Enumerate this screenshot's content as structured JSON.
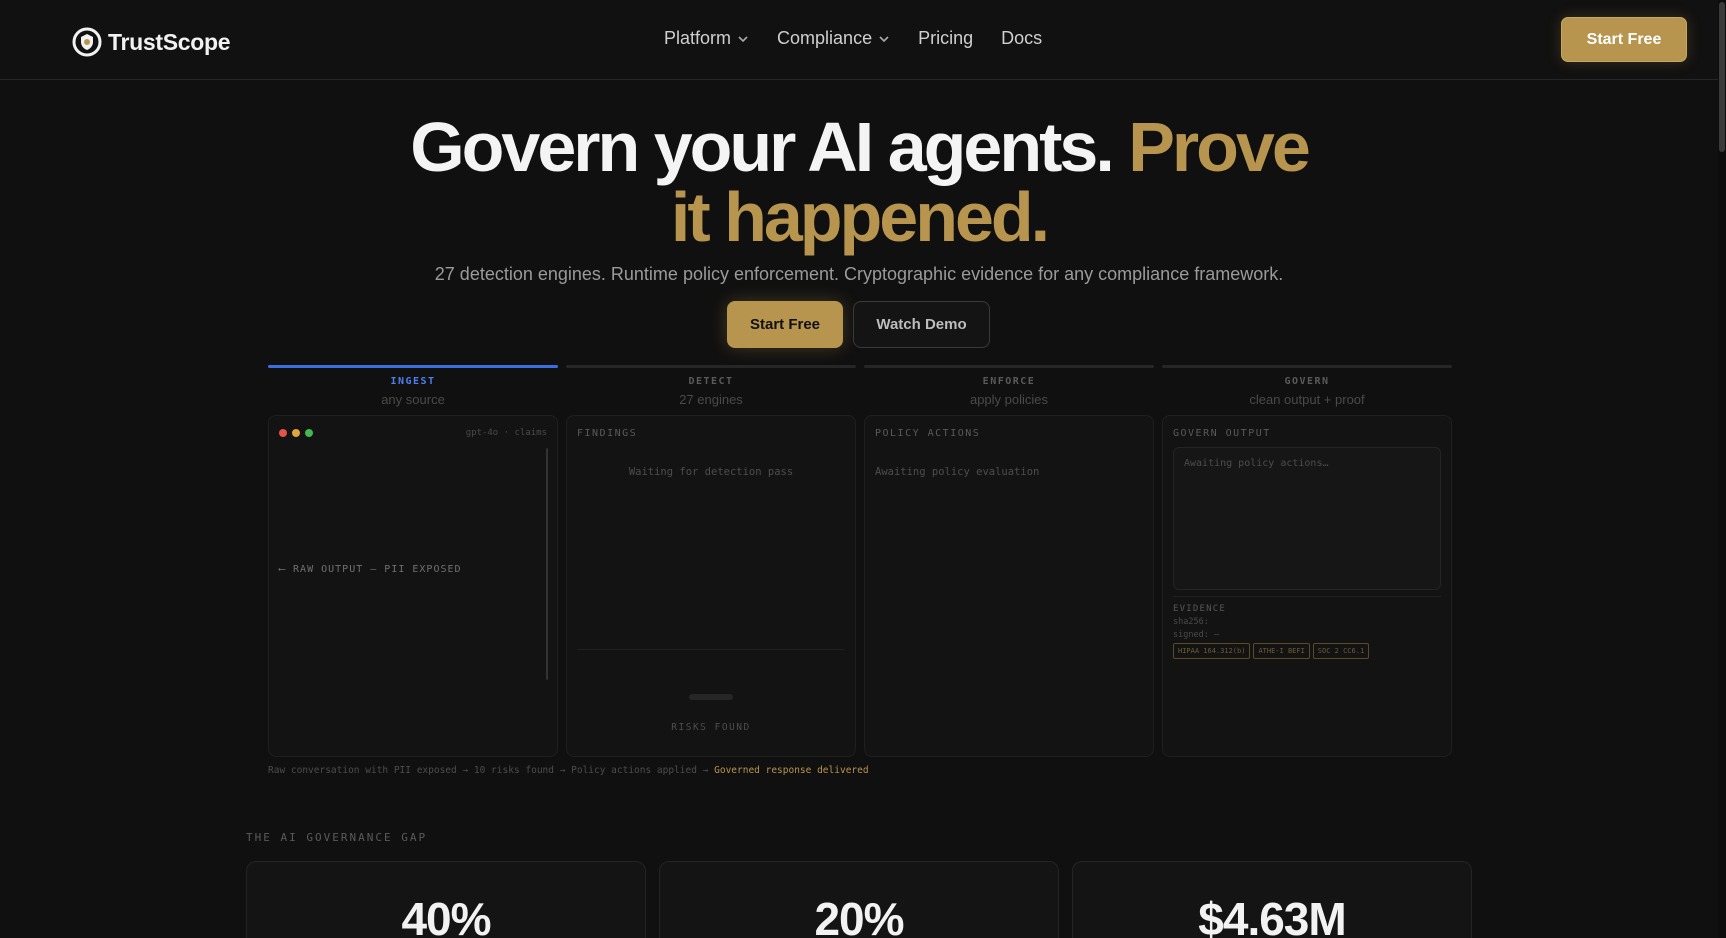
{
  "brand": {
    "name": "TrustScope",
    "logo_icon": "shield-logo-icon"
  },
  "nav": {
    "items": [
      {
        "label": "Platform",
        "has_dropdown": true
      },
      {
        "label": "Compliance",
        "has_dropdown": true
      },
      {
        "label": "Pricing",
        "has_dropdown": false
      },
      {
        "label": "Docs",
        "has_dropdown": false
      }
    ],
    "cta": "Start Free"
  },
  "hero": {
    "title_white": "Govern your AI agents.",
    "title_gold_1": "Prove",
    "title_gold_2": "it happened.",
    "subtitle": "27 detection engines. Runtime policy enforcement. Cryptographic evidence for any compliance framework.",
    "primary_cta": "Start Free",
    "secondary_cta": "Watch Demo"
  },
  "pipeline": {
    "stages": [
      {
        "tag": "INGEST",
        "sub": "any source",
        "active": true
      },
      {
        "tag": "DETECT",
        "sub": "27 engines",
        "active": false
      },
      {
        "tag": "ENFORCE",
        "sub": "apply policies",
        "active": false
      },
      {
        "tag": "GOVERN",
        "sub": "clean output + proof",
        "active": false
      }
    ],
    "ingest": {
      "meta": "gpt-4o · claims",
      "raw_label": "⟵ RAW OUTPUT — PII EXPOSED"
    },
    "detect": {
      "title": "FINDINGS",
      "waiting": "Waiting for detection pass",
      "risk_label": "RISKS FOUND"
    },
    "enforce": {
      "title": "POLICY ACTIONS",
      "waiting": "Awaiting policy evaluation"
    },
    "govern": {
      "title": "GOVERN OUTPUT",
      "waiting": "Awaiting policy actions…",
      "evidence_label": "EVIDENCE",
      "sha_line": "sha256:",
      "signed_line": "signed: —",
      "badges": [
        "HIPAA 164.312(b)",
        "ATHE-I BEFI",
        "SOC 2 CC6.1"
      ]
    },
    "caption_plain": "Raw conversation with PII exposed → 10 risks found → Policy actions applied →",
    "caption_highlight": "Governed response delivered"
  },
  "gap": {
    "label": "THE AI GOVERNANCE GAP",
    "stats": [
      {
        "value": "40%"
      },
      {
        "value": "20%"
      },
      {
        "value": "$4.63M"
      }
    ]
  },
  "colors": {
    "accent_gold": "#b8954f",
    "active_blue": "#3b6fe0",
    "background": "#101010"
  }
}
